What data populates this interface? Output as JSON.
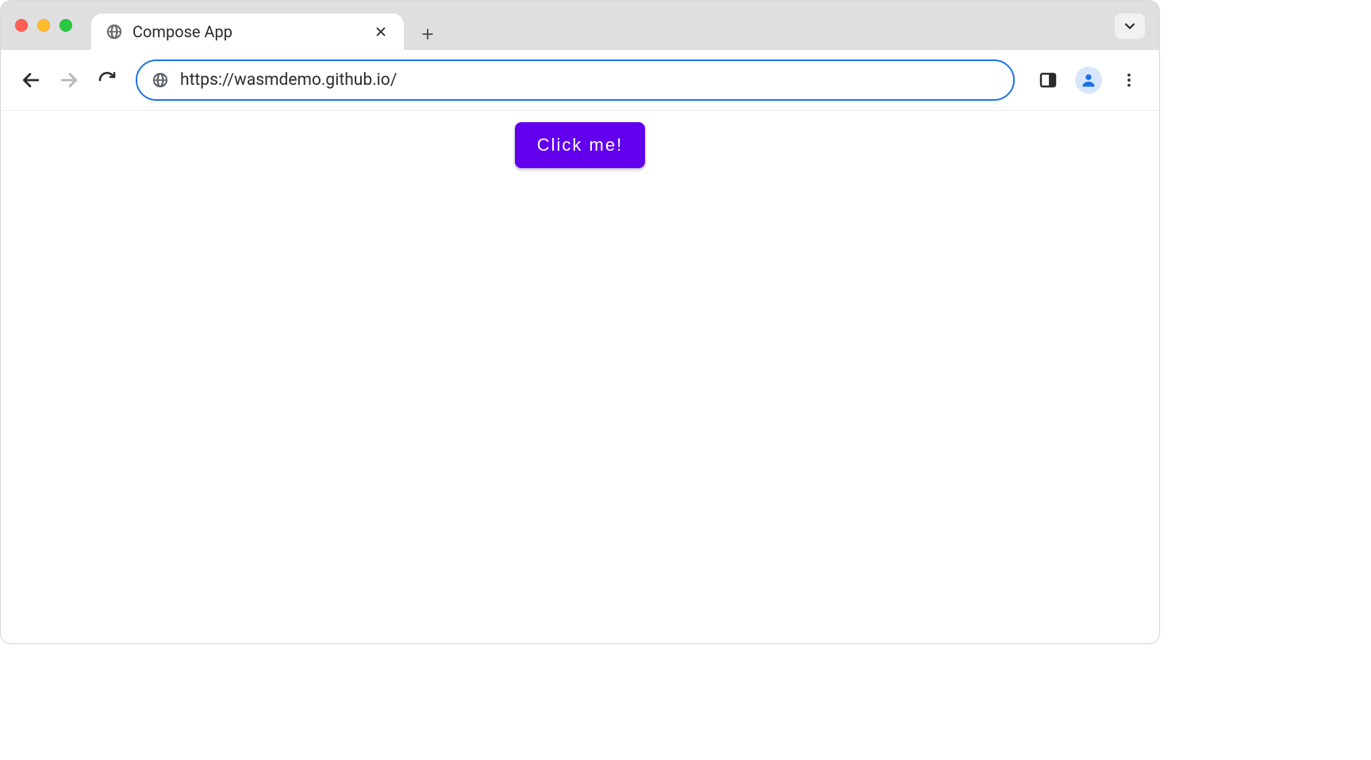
{
  "tab": {
    "title": "Compose App"
  },
  "toolbar": {
    "url": "https://wasmdemo.github.io/"
  },
  "page": {
    "cta_label": "Click me!"
  },
  "colors": {
    "accent": "#6200ee",
    "url_outline": "#1a73e8"
  }
}
